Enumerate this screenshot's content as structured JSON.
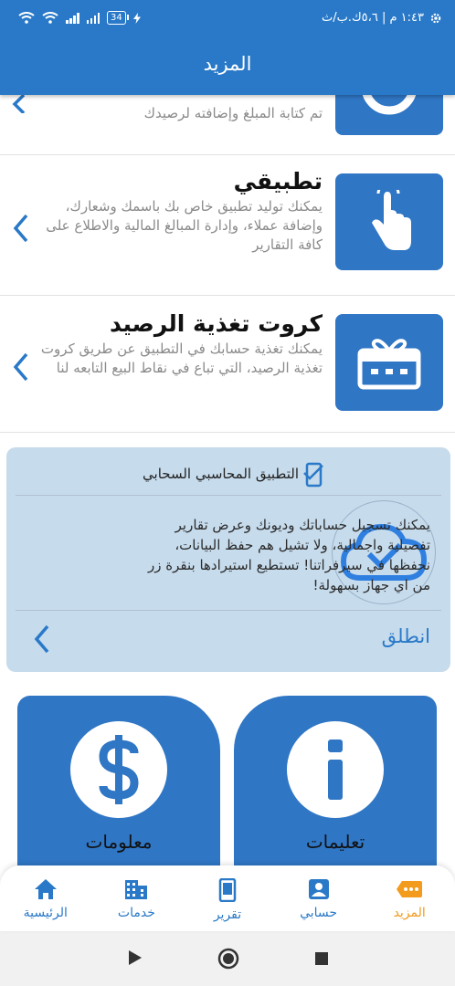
{
  "status_bar": {
    "time": "١:٤٣ م | ٥،٦ك.ب/ث",
    "battery": "34"
  },
  "header": {
    "title": "المزيد"
  },
  "top_partial": {
    "desc_tail": "تم كتابة المبلغ وإضافته لرصيدك"
  },
  "services": [
    {
      "title": "تطبيقي",
      "desc": "يمكنك توليد تطبيق خاص بك باسمك وشعارك، وإضافة عملاء، وإدارة المبالغ المالية والاطلاع على كافة التقارير",
      "icon": "hand-tap-icon"
    },
    {
      "title": "كروت تغذية الرصيد",
      "desc": "يمكنك تغذية حسابك في التطبيق عن طريق كروت تغذية الرصيد، التي تباع في نقاط البيع التابعه لنا",
      "icon": "gift-card-icon"
    }
  ],
  "cloud_card": {
    "title": "التطبيق المحاسبي السحابي",
    "desc": "يمكنك تسجيل حساباتك وديونك وعرض تقارير تفصيلية واجمالية، ولا تشيل هم حفظ البيانات، نحفظها في سيرفراتنا! تستطيع استيرادها بنقرة زر من اي جهاز بسهولة!",
    "action": "انطلق"
  },
  "big_cards": [
    {
      "label": "تعليمات",
      "icon": "info-icon"
    },
    {
      "label": "معلومات",
      "icon": "dollar-icon"
    }
  ],
  "bottom_nav": [
    {
      "label": "المزيد",
      "icon": "more-icon",
      "active": true
    },
    {
      "label": "حسابي",
      "icon": "account-icon"
    },
    {
      "label": "تقرير",
      "icon": "phone-report-icon"
    },
    {
      "label": "خدمات",
      "icon": "building-icon"
    },
    {
      "label": "الرئيسية",
      "icon": "home-icon"
    }
  ],
  "colors": {
    "primary": "#2979c8",
    "tile": "#2f76c5",
    "card_bg": "#c6dbec",
    "active": "#f29b1d"
  }
}
